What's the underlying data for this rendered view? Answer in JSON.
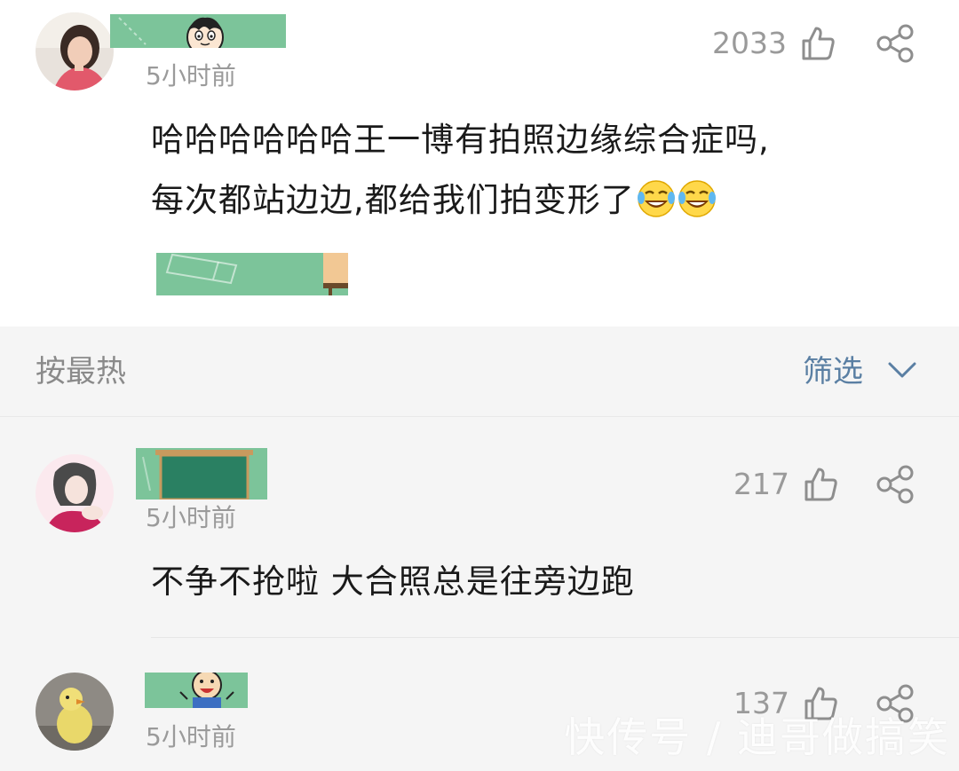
{
  "top_comment": {
    "time": "5小时前",
    "like_count": "2033",
    "text_line1": "哈哈哈哈哈哈王一博有拍照边缘综合症吗,",
    "text_line2": "每次都站边边,都给我们拍变形了",
    "emojis": [
      "laugh-cry-emoji",
      "laugh-cry-emoji"
    ]
  },
  "filter_bar": {
    "sort_label": "按最热",
    "filter_label": "筛选"
  },
  "replies": [
    {
      "time": "5小时前",
      "like_count": "217",
      "text": "不争不抢啦 大合照总是往旁边跑"
    },
    {
      "time": "5小时前",
      "like_count": "137"
    }
  ],
  "watermark": "快传号 / 迪哥做搞笑",
  "colors": {
    "mask_green": "#7cc49a",
    "link_blue": "#5a7fa3",
    "muted_gray": "#9a9a9a",
    "section_bg": "#f5f5f5"
  }
}
